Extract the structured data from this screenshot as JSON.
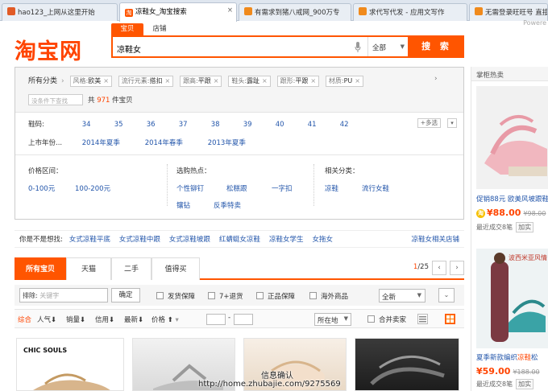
{
  "browser": {
    "tabs": [
      {
        "label": "hao123_上网从这里开始",
        "active": false,
        "fav": "#e15b26"
      },
      {
        "label": "凉鞋女_淘宝搜索",
        "active": true,
        "fav": "#ff5500"
      },
      {
        "label": "有需求到猪八戒网_900万专",
        "active": false,
        "fav": "#f08a1c"
      },
      {
        "label": "求代写代发 - 应用文写作",
        "active": false,
        "fav": "#f08a1c"
      },
      {
        "label": "无需登录旺旺号 直接",
        "active": false,
        "fav": "#f08a1c"
      }
    ],
    "powered": "Powere"
  },
  "header": {
    "logo": "淘宝网",
    "search_tabs": [
      "宝贝",
      "店铺"
    ],
    "query": "凉鞋女",
    "scope": "全部",
    "search_button": "搜 索"
  },
  "filters": {
    "all_categories": "所有分类",
    "chips": [
      {
        "k": "风格:",
        "v": "欧美"
      },
      {
        "k": "流行元素:",
        "v": "搭扣"
      },
      {
        "k": "跟高:",
        "v": "平跟"
      },
      {
        "k": "鞋头:",
        "v": "露趾"
      },
      {
        "k": "跟形:",
        "v": "平跟"
      },
      {
        "k": "材质:",
        "v": "PU"
      }
    ],
    "within_placeholder": "没条件下查找",
    "count_prefix": "共",
    "count": "971",
    "count_suffix": "件宝贝",
    "size_label": "鞋码:",
    "sizes": [
      "34",
      "35",
      "36",
      "37",
      "38",
      "39",
      "40",
      "41",
      "42"
    ],
    "multi_label": "+多选",
    "season_label": "上市年份...",
    "seasons": [
      "2014年夏季",
      "2014年春季",
      "2013年夏季"
    ],
    "price_label": "价格区间：",
    "prices": [
      "0-100元",
      "100-200元"
    ],
    "hot_label": "选购热点：",
    "hots": [
      "个性铆钉",
      "松糕跟",
      "一字扣",
      "镶钻",
      "反季特卖"
    ],
    "related_label": "相关分类：",
    "related": [
      "凉鞋",
      "流行女鞋"
    ]
  },
  "suggest": {
    "label": "你是不是想找:",
    "items": [
      "女式凉鞋平底",
      "女式凉鞋中跟",
      "女式凉鞋坡跟",
      "红蜻蜓女凉鞋",
      "凉鞋女学生",
      "女拖女"
    ],
    "right": "凉鞋女相关店铺"
  },
  "product_tabs": {
    "tabs": [
      "所有宝贝",
      "天猫",
      "二手",
      "值得买"
    ],
    "page_current": "1",
    "page_total": "/25"
  },
  "toolbar": {
    "exclude_label": "排除:",
    "exclude_placeholder": "关键字",
    "ok": "确定",
    "checks": [
      "发货保障",
      "7+退货",
      "正品保障",
      "海外商品"
    ],
    "sort_select": "全新",
    "sorts": [
      "综合",
      "人气",
      "销量",
      "信用",
      "最新",
      "价格"
    ],
    "location": "所在地",
    "merge": "合并卖家"
  },
  "products": [
    {
      "brand": "CHIC SOULS"
    }
  ],
  "right_panel": {
    "title": "掌柜热卖",
    "items": [
      {
        "title_pre": "促销88元 欧美风",
        "title_hl": "",
        "title_post": "坡跟鞋",
        "price": "¥88.00",
        "old": "¥98.00",
        "sold": "最近成交8笔",
        "btn": "加实"
      },
      {
        "title_pre": "夏季新款编织",
        "title_hl": "凉鞋",
        "title_post": "松",
        "price": "¥59.00",
        "old": "¥188.00",
        "sold": "最近成交8笔",
        "btn": "加实"
      }
    ],
    "banner": "波西米亚风情"
  },
  "watermark": {
    "line1": "信息确认",
    "line2": "http://home.zhubajie.com/9275569"
  }
}
